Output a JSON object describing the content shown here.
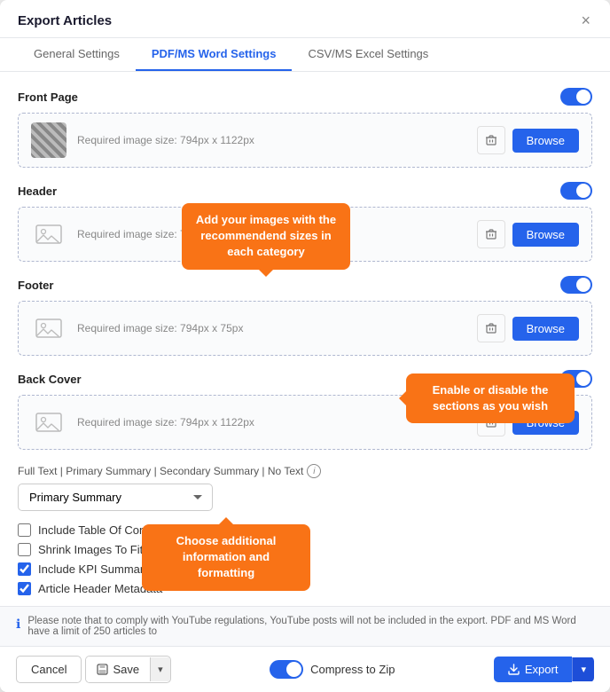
{
  "modal": {
    "title": "Export Articles",
    "close_label": "×"
  },
  "tabs": [
    {
      "id": "general",
      "label": "General Settings",
      "active": false
    },
    {
      "id": "pdf",
      "label": "PDF/MS Word Settings",
      "active": true
    },
    {
      "id": "csv",
      "label": "CSV/MS Excel Settings",
      "active": false
    }
  ],
  "sections": [
    {
      "id": "front-page",
      "label": "Front Page",
      "toggle": true,
      "image_hint": "Required image size: 794px x 1122px",
      "type": "portrait"
    },
    {
      "id": "header",
      "label": "Header",
      "toggle": true,
      "image_hint": "Required image size: 794px x 75px",
      "type": "landscape"
    },
    {
      "id": "footer",
      "label": "Footer",
      "toggle": true,
      "image_hint": "Required image size: 794px x 75px",
      "type": "landscape"
    },
    {
      "id": "back-cover",
      "label": "Back Cover",
      "toggle": true,
      "image_hint": "Required image size: 794px x 1122px",
      "type": "portrait"
    }
  ],
  "text_options": {
    "label": "Full Text | Primary Summary | Secondary Summary | No Text",
    "dropdown_value": "Primary Summary",
    "dropdown_options": [
      "Full Text",
      "Primary Summary",
      "Secondary Summary",
      "No Text"
    ]
  },
  "checkboxes": [
    {
      "id": "toc",
      "label": "Include Table Of Contents",
      "checked": false
    },
    {
      "id": "shrink",
      "label": "Shrink Images To Fit Single Page",
      "checked": false
    },
    {
      "id": "kpi",
      "label": "Include KPI Summary",
      "checked": true
    },
    {
      "id": "meta",
      "label": "Article Header Metadata",
      "checked": true
    }
  ],
  "info_bar": {
    "text": "Please note that to comply with YouTube regulations, YouTube posts will not be included in the export. PDF and MS Word have a limit of 250 articles to"
  },
  "footer": {
    "cancel_label": "Cancel",
    "save_label": "Save",
    "compress_label": "Compress to Zip",
    "export_label": "Export"
  },
  "callouts": {
    "images": "Add your images with the recommendend sizes in each category",
    "sections": "Enable or disable the sections as you wish",
    "additional": "Choose additional information and formatting"
  }
}
